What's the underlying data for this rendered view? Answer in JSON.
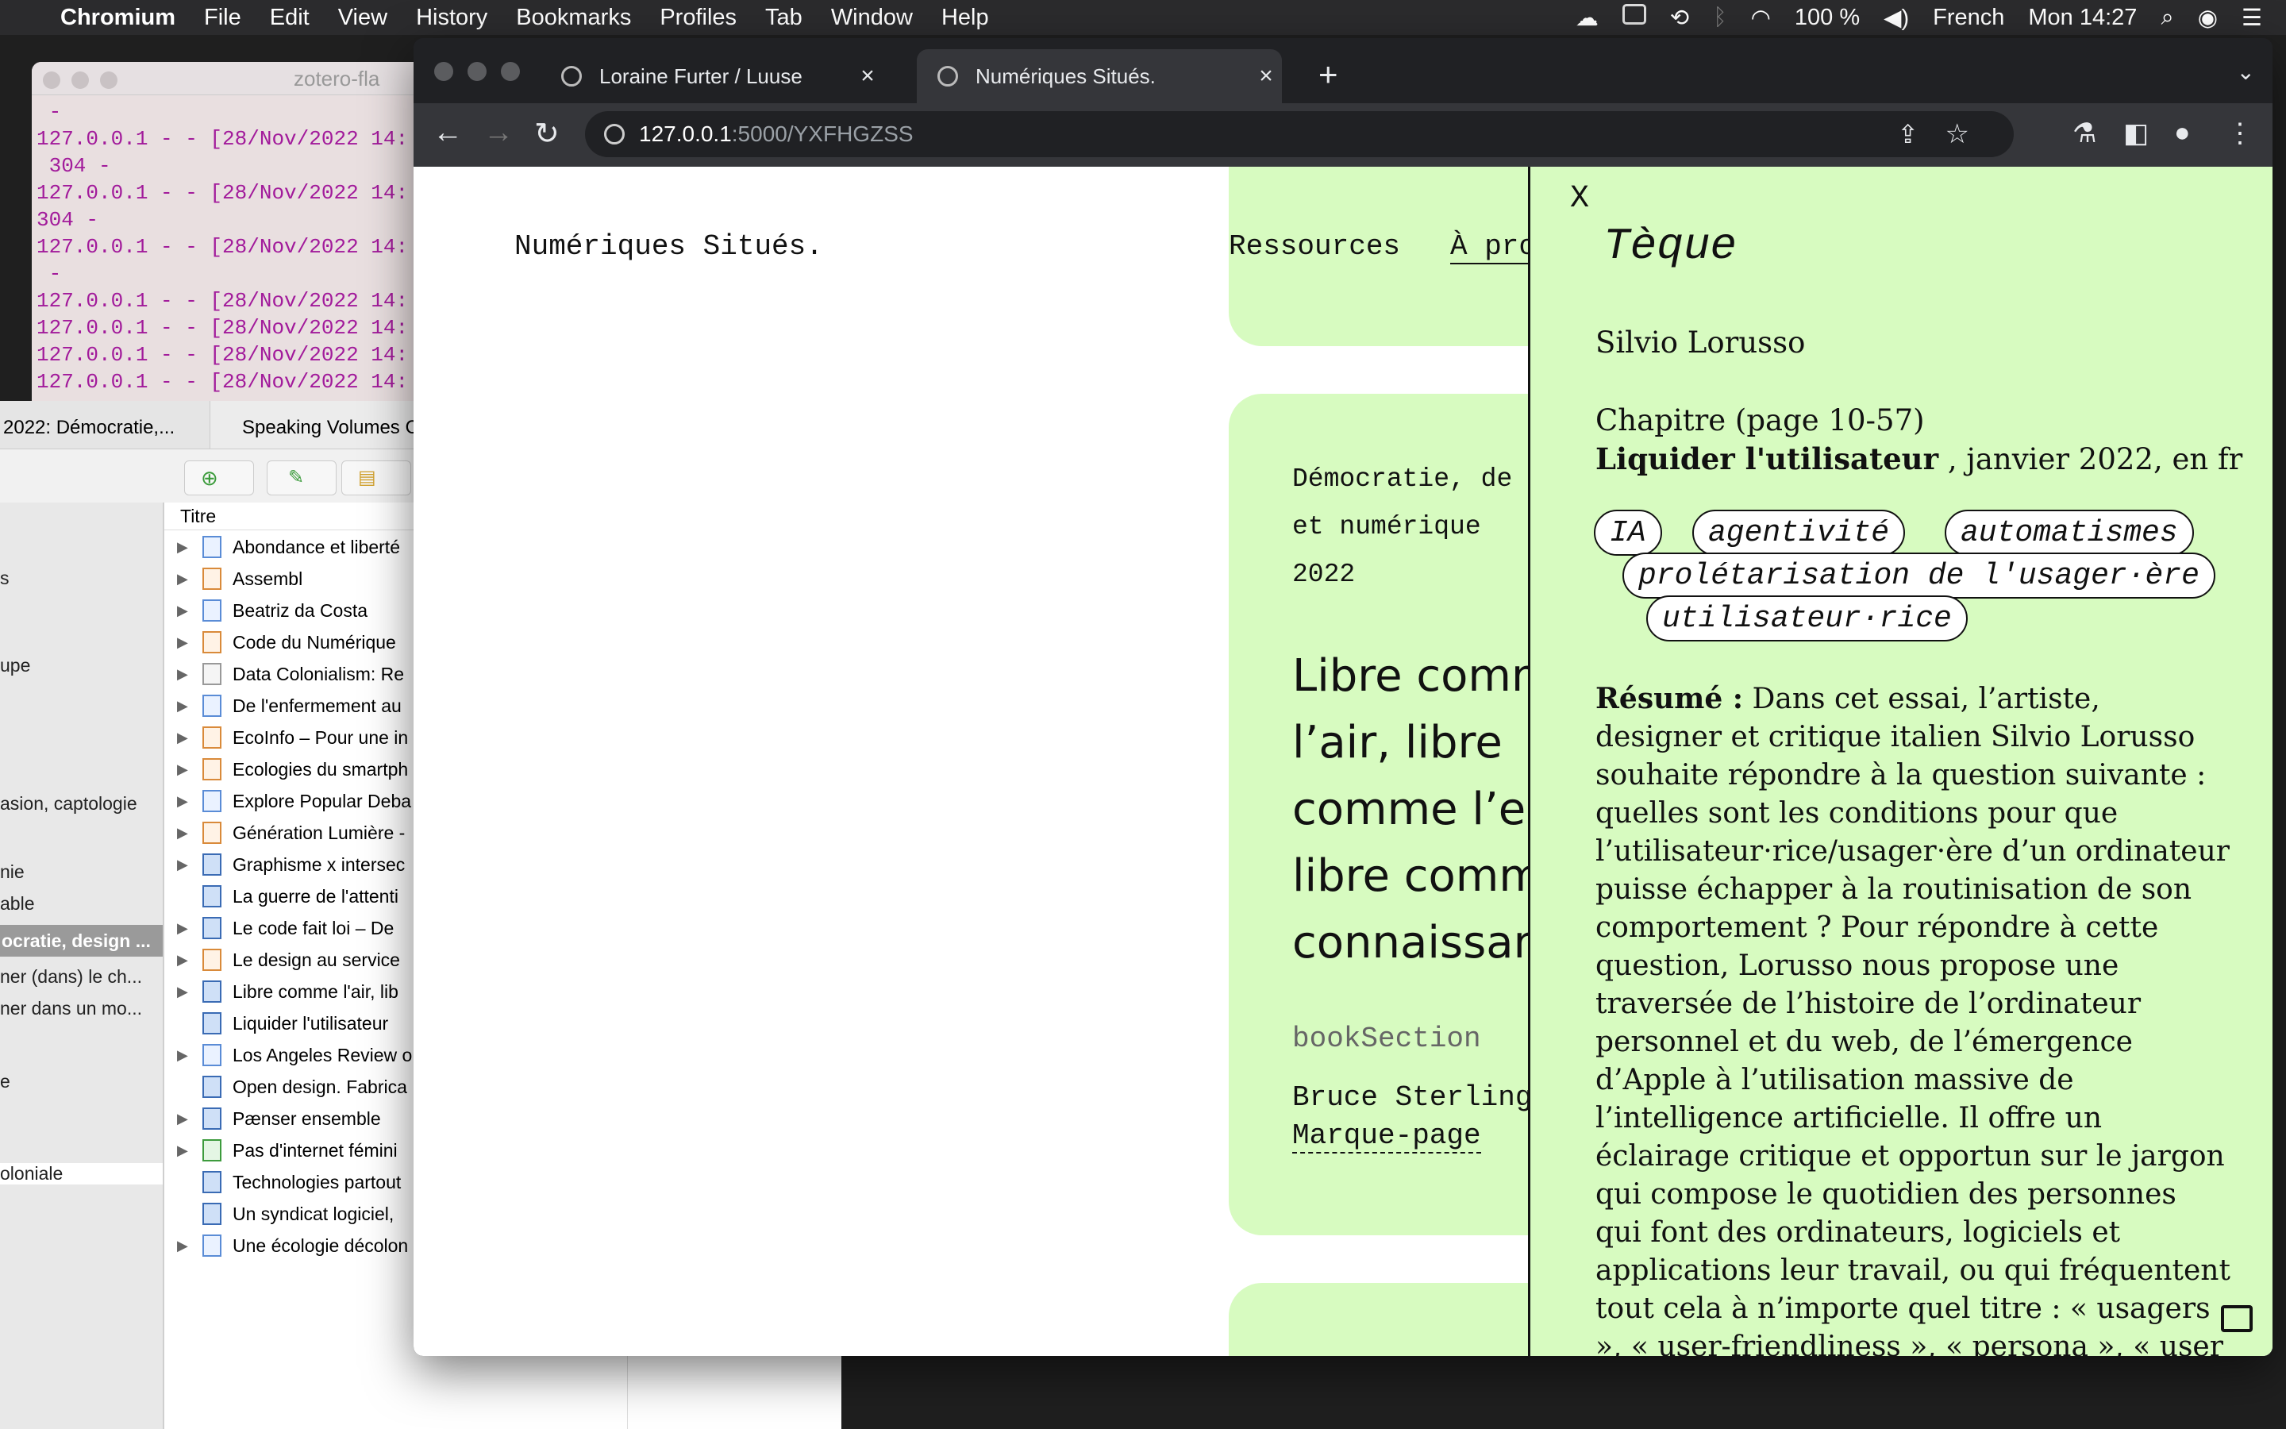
{
  "menubar": {
    "app": "Chromium",
    "items": [
      "File",
      "Edit",
      "View",
      "History",
      "Bookmarks",
      "Profiles",
      "Tab",
      "Window",
      "Help"
    ],
    "battery": "100 %",
    "language": "French",
    "clock": "Mon 14:27"
  },
  "terminal": {
    "title": "zotero-fla",
    "lines": [
      " -",
      "127.0.0.1 - - [28/Nov/2022 14:",
      " 304 -",
      "127.0.0.1 - - [28/Nov/2022 14:",
      "304 -",
      "127.0.0.1 - - [28/Nov/2022 14:",
      " -",
      "127.0.0.1 - - [28/Nov/2022 14:",
      "127.0.0.1 - - [28/Nov/2022 14:",
      "127.0.0.1 - - [28/Nov/2022 14:",
      "127.0.0.1 - - [28/Nov/2022 14:"
    ]
  },
  "zotero": {
    "tabs": [
      "2022: Démocratie,...",
      "Speaking Volumes C"
    ],
    "column_title": "Titre",
    "collections": [
      "s",
      "upe",
      "asion, captologie",
      "nie",
      "able",
      "ocratie, design ...",
      "ner (dans) le ch...",
      "ner dans un mo...",
      "e",
      "oloniale"
    ],
    "items": [
      "Abondance et liberté",
      "Assembl",
      "Beatriz da Costa",
      "Code du Numérique",
      "Data Colonialism: Re",
      "De l'enfermement au",
      "EcoInfo – Pour une in",
      "Ecologies du smartph",
      "Explore Popular Deba",
      "Génération Lumière -",
      "Graphisme x intersec",
      "La guerre de l'attenti",
      "Le code fait loi – De",
      "Le design au service",
      "Libre comme l'air, lib",
      "Liquider l'utilisateur",
      "Los Angeles Review o",
      "Open design. Fabrica",
      "Pænser ensemble",
      "Pas d'internet fémini",
      "Technologies partout",
      "Un syndicat logiciel,",
      "Une écologie décolon"
    ]
  },
  "browser": {
    "tabs": [
      {
        "title": "Loraine Furter / Luuse"
      },
      {
        "title": "Numériques Situés."
      }
    ],
    "url_host": "127.0.0.1",
    "url_rest": ":5000/YXFHGZSS"
  },
  "site": {
    "title": "Numériques Situés.",
    "nav": {
      "resources": "Ressources",
      "about": "À propos"
    },
    "card": {
      "meta1": "Démocratie, de",
      "meta2": "et numérique",
      "meta3": "2022",
      "title_lines": [
        "Libre comm",
        "l’air, libre",
        "comme l’ea",
        "libre comm",
        "connaissan"
      ],
      "type": "bookSection",
      "author": "Bruce Sterling",
      "bookmark": "Marque-page"
    }
  },
  "panel": {
    "close": "X",
    "title": "Tèque",
    "author": "Silvio Lorusso",
    "chapter": "Chapitre (page 10-57)",
    "work_title": "Liquider l'utilisateur",
    "work_rest": " , janvier 2022, en fr",
    "tags": [
      "IA",
      "agentivité",
      "automatismes",
      "prolétarisation de l'usager·ère",
      "utilisateur·rice"
    ],
    "summary_label": "Résumé :",
    "summary_text": " Dans cet essai, l’artiste, designer et critique italien Silvio Lorusso souhaite répondre à la question suivante : quelles sont les conditions pour que l’utilisateur·rice/usager·ère d’un ordinateur puisse échapper à la routinisation de son comportement ? Pour répondre à cette question, Lorusso nous propose une traversée de l’histoire de l’ordinateur personnel et du web, de l’émergence d’Apple à l’utilisation massive de l’intelligence artificielle. Il offre un éclairage critique et opportun sur le jargon qui compose le quotidien des personnes qui font des ordinateurs, logiciels et applications leur travail, ou qui fréquentent tout cela à n’importe quel titre : « usagers », « user-friendliness », « persona », « user journeys »,"
  }
}
